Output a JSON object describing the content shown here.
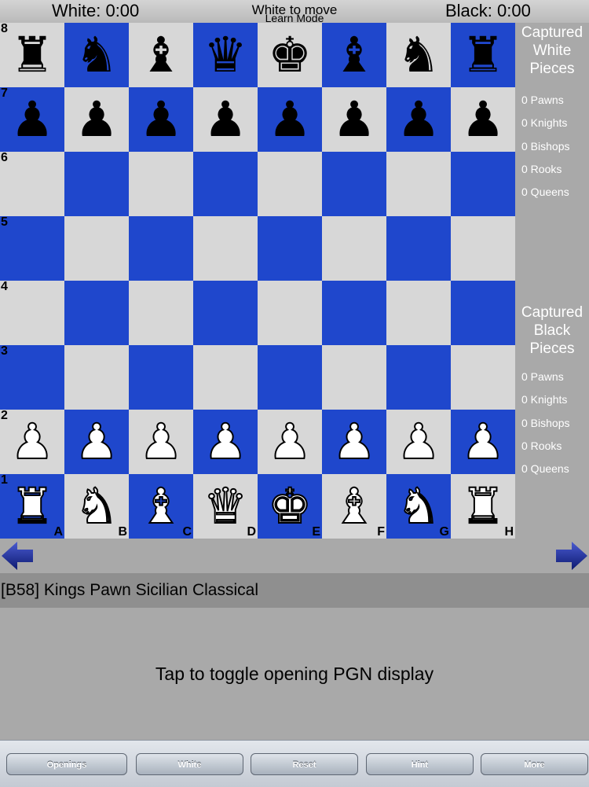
{
  "header": {
    "white_clock": "White: 0:00",
    "black_clock": "Black: 0:00",
    "turn_status": "White to move",
    "mode": "Learn Mode"
  },
  "board": {
    "ranks": [
      "8",
      "7",
      "6",
      "5",
      "4",
      "3",
      "2",
      "1"
    ],
    "files": [
      "A",
      "B",
      "C",
      "D",
      "E",
      "F",
      "G",
      "H"
    ],
    "position": [
      [
        "br",
        "bn",
        "bb",
        "bq",
        "bk",
        "bb",
        "bn",
        "br"
      ],
      [
        "bp",
        "bp",
        "bp",
        "bp",
        "bp",
        "bp",
        "bp",
        "bp"
      ],
      [
        "",
        "",
        "",
        "",
        "",
        "",
        "",
        ""
      ],
      [
        "",
        "",
        "",
        "",
        "",
        "",
        "",
        ""
      ],
      [
        "",
        "",
        "",
        "",
        "",
        "",
        "",
        ""
      ],
      [
        "",
        "",
        "",
        "",
        "",
        "",
        "",
        ""
      ],
      [
        "wp",
        "wp",
        "wp",
        "wp",
        "wp",
        "wp",
        "wp",
        "wp"
      ],
      [
        "wr",
        "wn",
        "wb",
        "wq",
        "wk",
        "wb",
        "wn",
        "wr"
      ]
    ],
    "colors": {
      "light": "#d7d7d7",
      "dark": "#1f47cc"
    }
  },
  "captured_white": {
    "title": "Captured White Pieces",
    "items": [
      "0 Pawns",
      "0 Knights",
      "0 Bishops",
      "0 Rooks",
      "0 Queens"
    ]
  },
  "captured_black": {
    "title": "Captured Black Pieces",
    "items": [
      "0 Pawns",
      "0 Knights",
      "0 Bishops",
      "0 Rooks",
      "0 Queens"
    ]
  },
  "nav": {
    "prev_icon": "arrow-left-icon",
    "next_icon": "arrow-right-icon",
    "arrow_color": "#1a2a8c"
  },
  "opening": {
    "name": "[B58] Kings Pawn Sicilian Classical"
  },
  "pgn": {
    "prompt": "Tap to toggle opening PGN display"
  },
  "toolbar": {
    "openings_label": "Openings",
    "white_label": "White",
    "reset_label": "Reset",
    "hint_label": "Hint",
    "more_label": "More"
  }
}
